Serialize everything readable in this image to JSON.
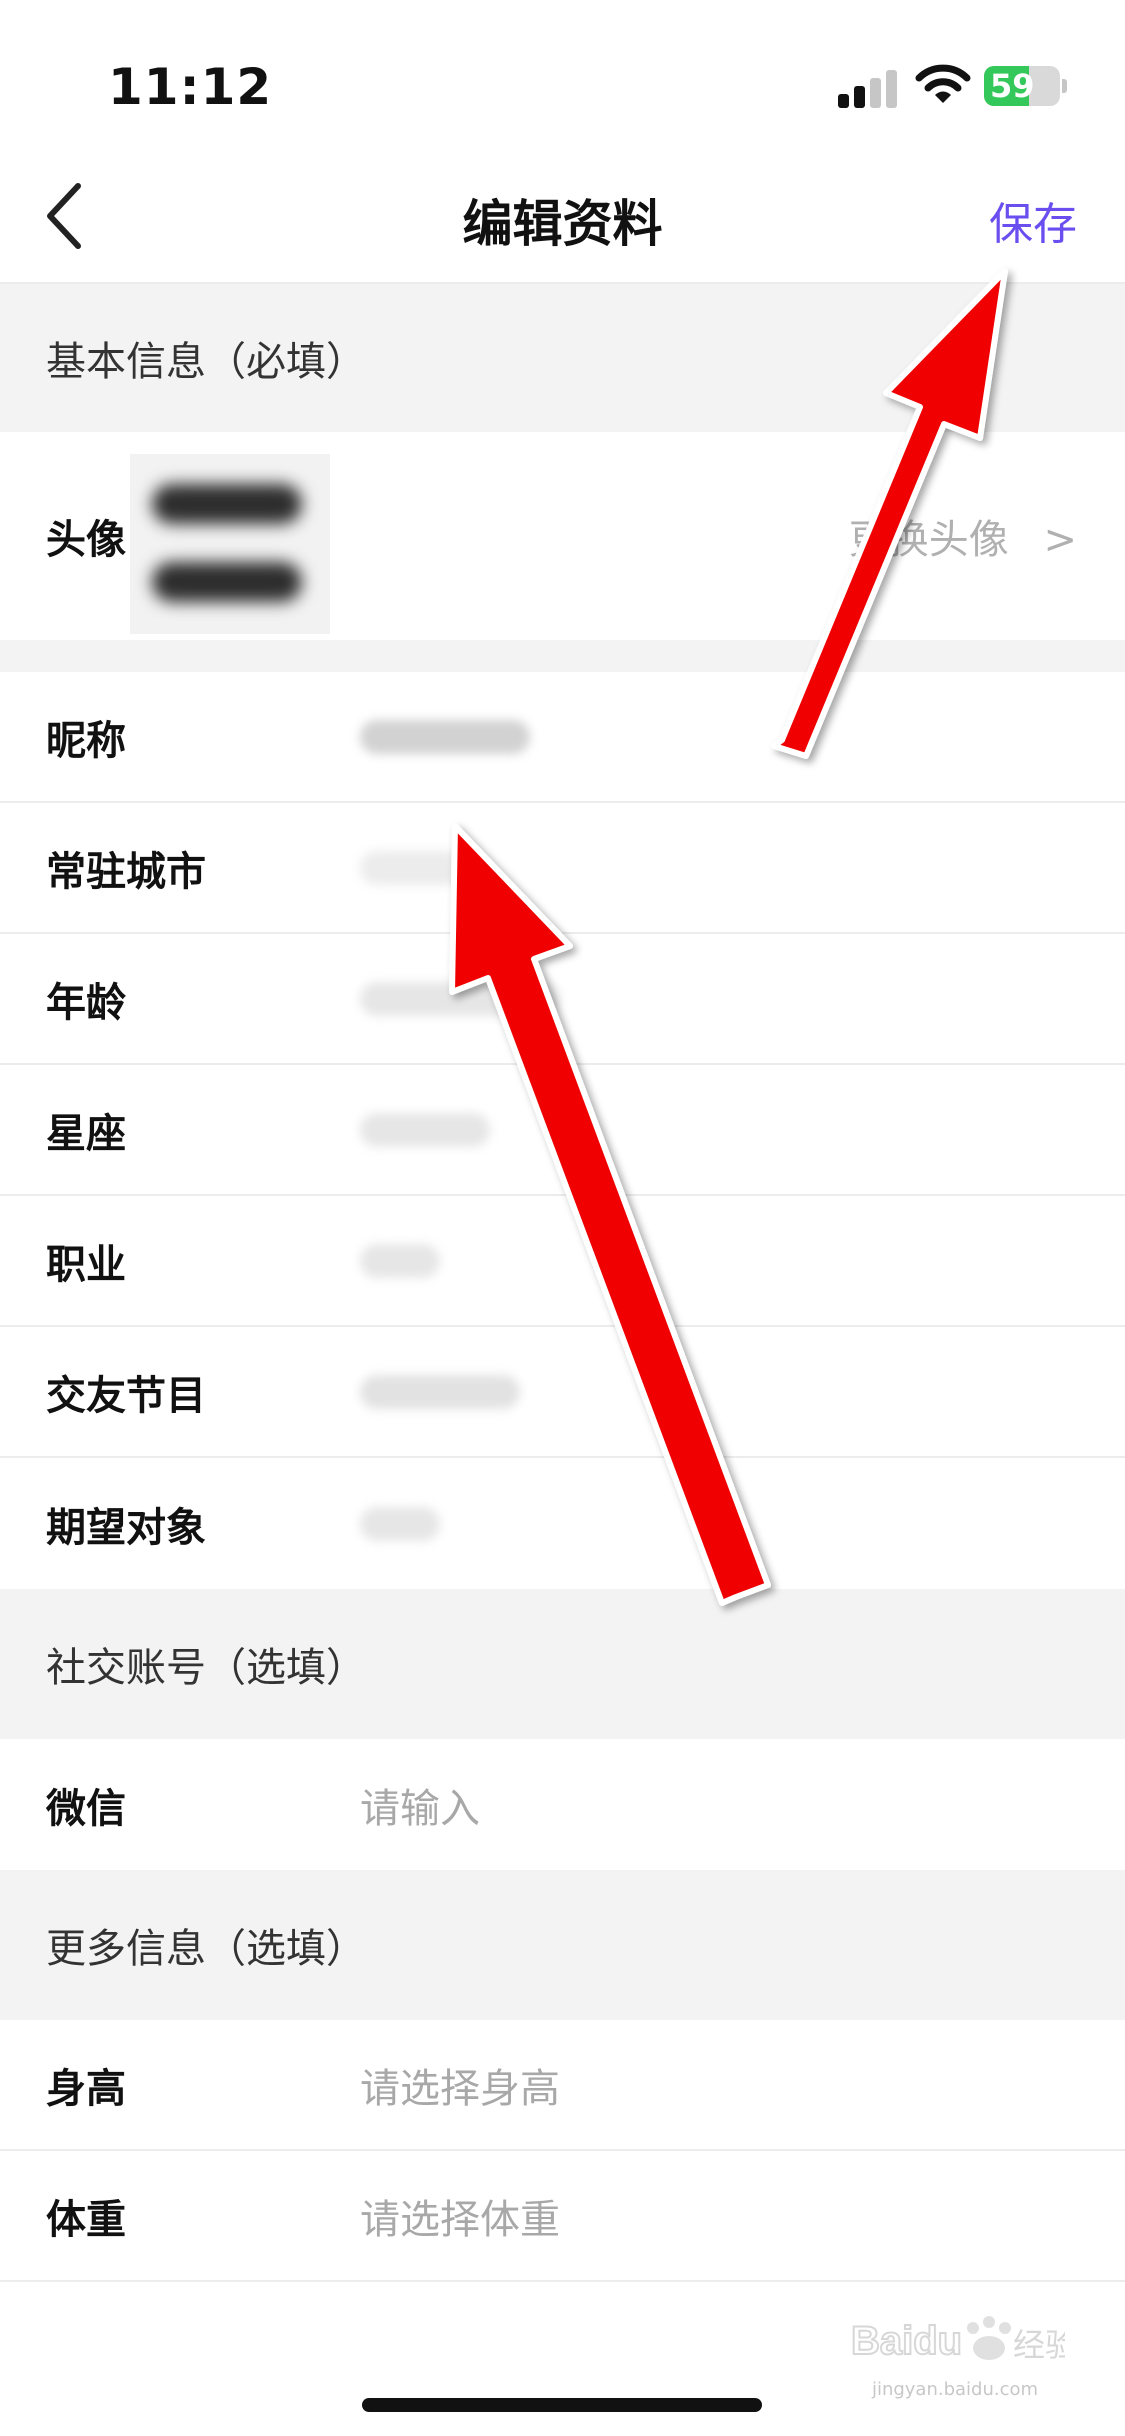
{
  "status_bar": {
    "time": "11:12",
    "battery_percent": 59,
    "battery_text": "59",
    "battery_color": "#34c759",
    "icons": [
      "signal-icon",
      "wifi-icon",
      "battery-icon"
    ]
  },
  "nav": {
    "title": "编辑资料",
    "save_label": "保存",
    "back_icon": "chevron-left-icon",
    "accent_color": "#6a4ef0"
  },
  "sections": {
    "basic": {
      "title": "基本信息（必填）",
      "avatar_label": "头像",
      "change_avatar_label": "更换头像",
      "change_avatar_chevron": ">",
      "fields": [
        {
          "label": "昵称"
        },
        {
          "label": "常驻城市"
        },
        {
          "label": "年龄"
        },
        {
          "label": "星座"
        },
        {
          "label": "职业"
        },
        {
          "label": "交友节目"
        },
        {
          "label": "期望对象"
        }
      ]
    },
    "social": {
      "title": "社交账号（选填）",
      "fields": [
        {
          "label": "微信",
          "placeholder": "请输入"
        }
      ]
    },
    "more": {
      "title": "更多信息（选填）",
      "fields": [
        {
          "label": "身高",
          "placeholder": "请选择身高"
        },
        {
          "label": "体重",
          "placeholder": "请选择体重"
        }
      ]
    }
  },
  "annotations": {
    "arrow_color": "#f00000",
    "arrow_count": 2
  },
  "watermark": {
    "brand": "Baidu",
    "product": "经验",
    "url": "jingyan.baidu.com"
  }
}
